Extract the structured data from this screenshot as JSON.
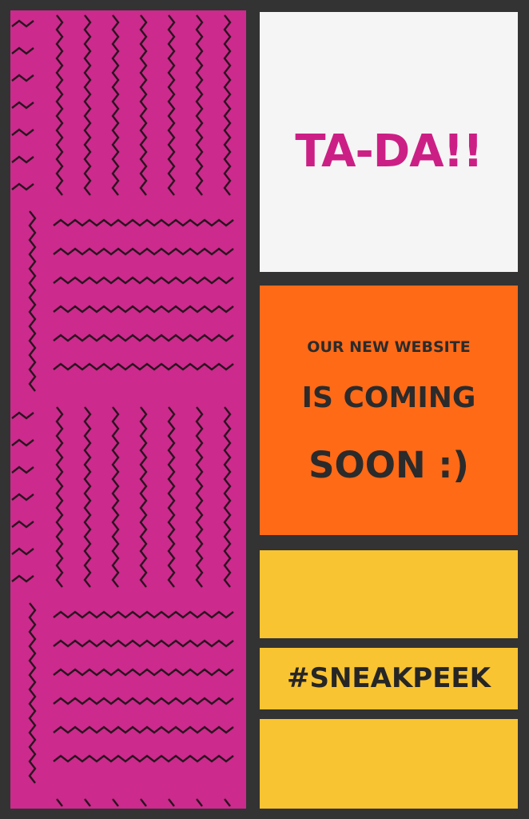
{
  "headline": "TA-DA!!",
  "announcement": {
    "line1": "OUR NEW WEBSITE",
    "line2": "IS COMING",
    "line3": "SOON :)"
  },
  "hashtag": "#SNEAKPEEK",
  "colors": {
    "background": "#333333",
    "pattern_panel": "#cc2a8c",
    "pattern_stroke": "#2a1420",
    "headline": "#cc1f85",
    "white_box": "#f5f5f5",
    "orange_box": "#ff6a17",
    "yellow_box": "#f9c431",
    "dark_text": "#2b2b2b"
  },
  "decor": {
    "pattern_icon": "zigzag-pattern"
  }
}
